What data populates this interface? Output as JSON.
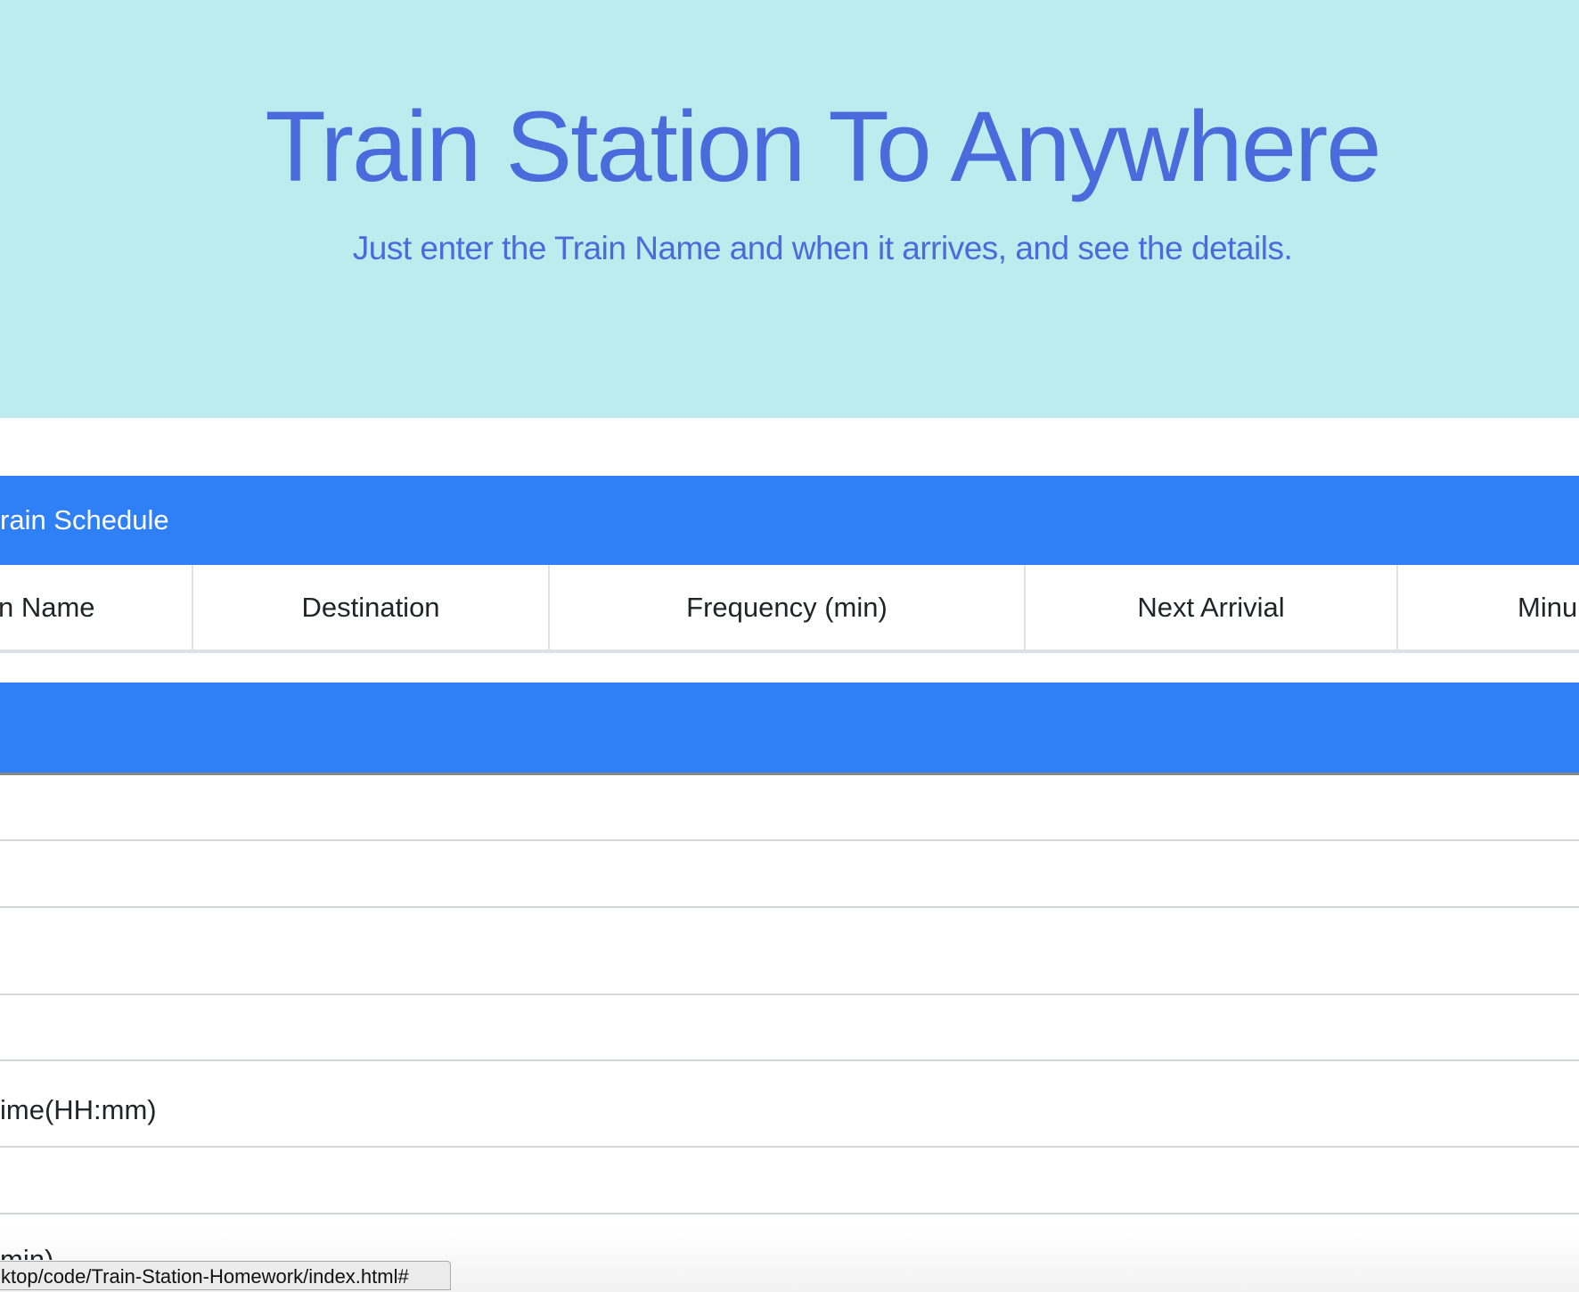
{
  "hero": {
    "title": "Train Station To Anywhere",
    "subtitle": "Just enter the Train Name and when it arrives, and see the details."
  },
  "schedule": {
    "heading": "rain Schedule",
    "columns": [
      "n Name",
      "Destination",
      "Frequency (min)",
      "Next Arrivial",
      "Minu"
    ]
  },
  "form": {
    "time_label": "ime(HH:mm)",
    "partial_label": "min)"
  },
  "status_bar": {
    "url": "ktop/code/Train-Station-Homework/index.html#"
  },
  "colors": {
    "hero_bg": "#bcecee",
    "title": "#4a6bdc",
    "panel_header": "#2f7ff6"
  }
}
